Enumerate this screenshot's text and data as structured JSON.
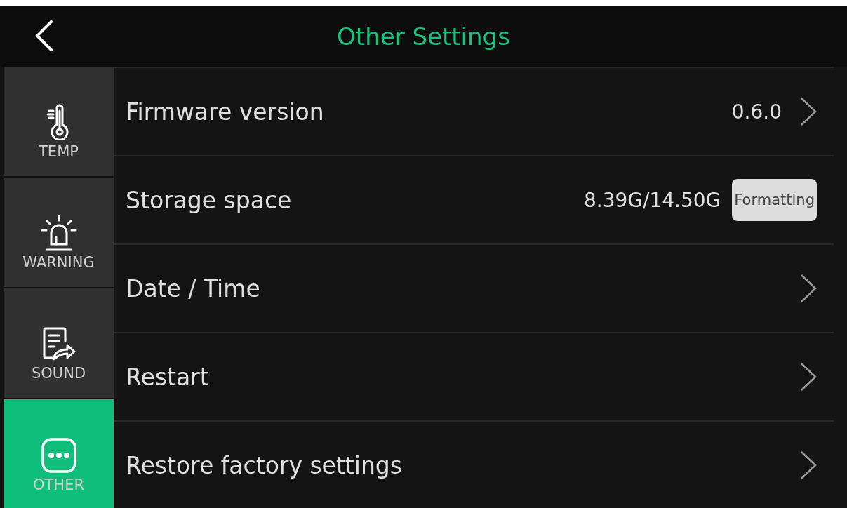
{
  "header": {
    "title": "Other Settings"
  },
  "sidebar": {
    "items": [
      {
        "label": "TEMP",
        "selected": false
      },
      {
        "label": "WARNING",
        "selected": false
      },
      {
        "label": "SOUND",
        "selected": false
      },
      {
        "label": "OTHER",
        "selected": true
      }
    ]
  },
  "rows": [
    {
      "kind": "link",
      "label": "Firmware version",
      "value": "0.6.0"
    },
    {
      "kind": "action",
      "label": "Storage space",
      "value": "8.39G/14.50G",
      "button": "Formatting"
    },
    {
      "kind": "link",
      "label": "Date / Time"
    },
    {
      "kind": "link",
      "label": "Restart"
    },
    {
      "kind": "link",
      "label": "Restore factory settings"
    }
  ]
}
